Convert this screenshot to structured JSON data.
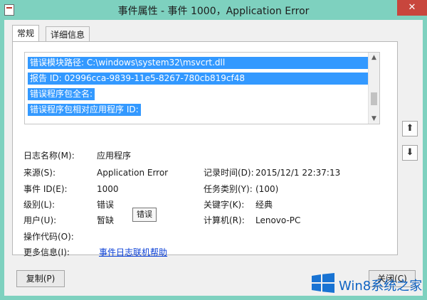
{
  "window": {
    "title": "事件属性 - 事件 1000，Application Error",
    "close_glyph": "✕"
  },
  "tabs": [
    {
      "label": "常规",
      "active": true
    },
    {
      "label": "详细信息",
      "active": false
    }
  ],
  "description_lines": [
    "错误模块路径: C:\\windows\\system32\\msvcrt.dll",
    "报告 ID: 02996cca-9839-11e5-8267-780cb819cf48",
    "错误程序包全名:",
    "错误程序包相对应用程序 ID:"
  ],
  "fields": {
    "log_name_label": "日志名称(M):",
    "log_name_value": "应用程序",
    "source_label": "来源(S):",
    "source_value": "Application Error",
    "logged_label": "记录时间(D):",
    "logged_value": "2015/12/1 22:37:13",
    "event_id_label": "事件 ID(E):",
    "event_id_value": "1000",
    "task_label": "任务类别(Y):",
    "task_value": "(100)",
    "level_label": "级别(L):",
    "level_value": "错误",
    "keywords_label": "关键字(K):",
    "keywords_value": "经典",
    "user_label": "用户(U):",
    "user_value": "暂缺",
    "computer_label": "计算机(R):",
    "computer_value": "Lenovo-PC",
    "opcode_label": "操作代码(O):",
    "more_info_label": "更多信息(I):",
    "more_info_link": "事件日志联机帮助"
  },
  "tooltip": "错误",
  "buttons": {
    "copy": "复制(P)",
    "close": "关闭(C)",
    "prev_glyph": "⬆",
    "next_glyph": "⬇"
  },
  "watermark": "Win8系统之家",
  "colors": {
    "titlebar": "#7ed1bf",
    "selection": "#3399ff",
    "close": "#c8463d",
    "link": "#0a3fd6"
  }
}
